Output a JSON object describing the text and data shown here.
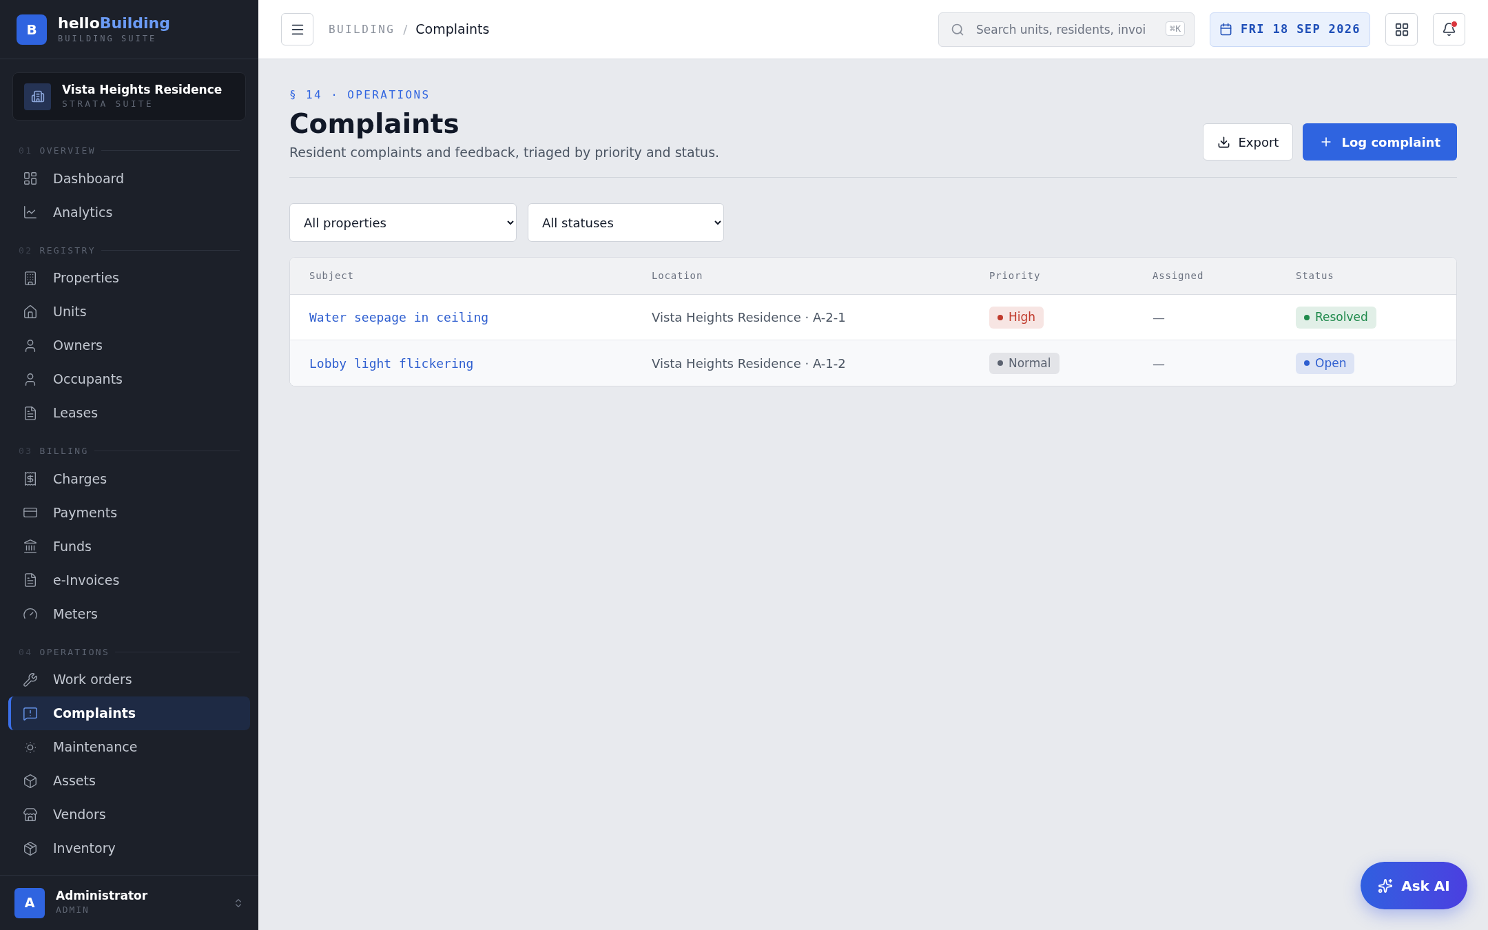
{
  "brand": {
    "name_part1": "hello",
    "name_part2": "Building",
    "logo_letter": "B",
    "subtitle": "BUILDING SUITE"
  },
  "property": {
    "name": "Vista Heights Residence",
    "subtitle": "STRATA SUITE"
  },
  "sidebar": {
    "sections": [
      {
        "number": "01",
        "label": "OVERVIEW",
        "items": [
          {
            "label": "Dashboard",
            "selected": false
          },
          {
            "label": "Analytics",
            "selected": false
          }
        ]
      },
      {
        "number": "02",
        "label": "REGISTRY",
        "items": [
          {
            "label": "Properties",
            "selected": false
          },
          {
            "label": "Units",
            "selected": false
          },
          {
            "label": "Owners",
            "selected": false
          },
          {
            "label": "Occupants",
            "selected": false
          },
          {
            "label": "Leases",
            "selected": false
          }
        ]
      },
      {
        "number": "03",
        "label": "BILLING",
        "items": [
          {
            "label": "Charges",
            "selected": false
          },
          {
            "label": "Payments",
            "selected": false
          },
          {
            "label": "Funds",
            "selected": false
          },
          {
            "label": "e-Invoices",
            "selected": false
          },
          {
            "label": "Meters",
            "selected": false
          }
        ]
      },
      {
        "number": "04",
        "label": "OPERATIONS",
        "items": [
          {
            "label": "Work orders",
            "selected": false
          },
          {
            "label": "Complaints",
            "selected": true
          },
          {
            "label": "Maintenance",
            "selected": false
          },
          {
            "label": "Assets",
            "selected": false
          },
          {
            "label": "Vendors",
            "selected": false
          },
          {
            "label": "Inventory",
            "selected": false
          }
        ]
      }
    ]
  },
  "user": {
    "initial": "A",
    "name": "Administrator",
    "role": "ADMIN"
  },
  "topbar": {
    "breadcrumb": [
      "BUILDING",
      "/",
      "Complaints"
    ],
    "search": {
      "placeholder": "Search units, residents, invoi",
      "shortcut": "⌘K"
    },
    "date": "FRI 18 SEP 2026",
    "notification_dot": true
  },
  "page": {
    "eyebrow": "§ 14 · OPERATIONS",
    "title": "Complaints",
    "subtitle": "Resident complaints and feedback, triaged by priority and status.",
    "buttons": [
      "Export",
      "Log complaint"
    ]
  },
  "filters": [
    {
      "value": "All properties"
    },
    {
      "value": "All statuses"
    }
  ],
  "table": {
    "columns": [
      "Subject",
      "Location",
      "Priority",
      "Assigned",
      "Status"
    ],
    "rows": [
      {
        "subject": "Water seepage in ceiling",
        "location": "Vista Heights Residence · A-2-1",
        "priority": {
          "label": "High",
          "color": "#c0392b"
        },
        "assigned": "—",
        "status": {
          "label": "Resolved",
          "color": "#1f8a4c"
        }
      },
      {
        "subject": "Lobby light flickering",
        "location": "Vista Heights Residence · A-1-2",
        "priority": {
          "label": "Normal",
          "color": "#5b6270"
        },
        "assigned": "—",
        "status": {
          "label": "Open",
          "color": "#2f5fd0"
        }
      }
    ]
  },
  "ask_ai": {
    "label": "Ask AI"
  }
}
